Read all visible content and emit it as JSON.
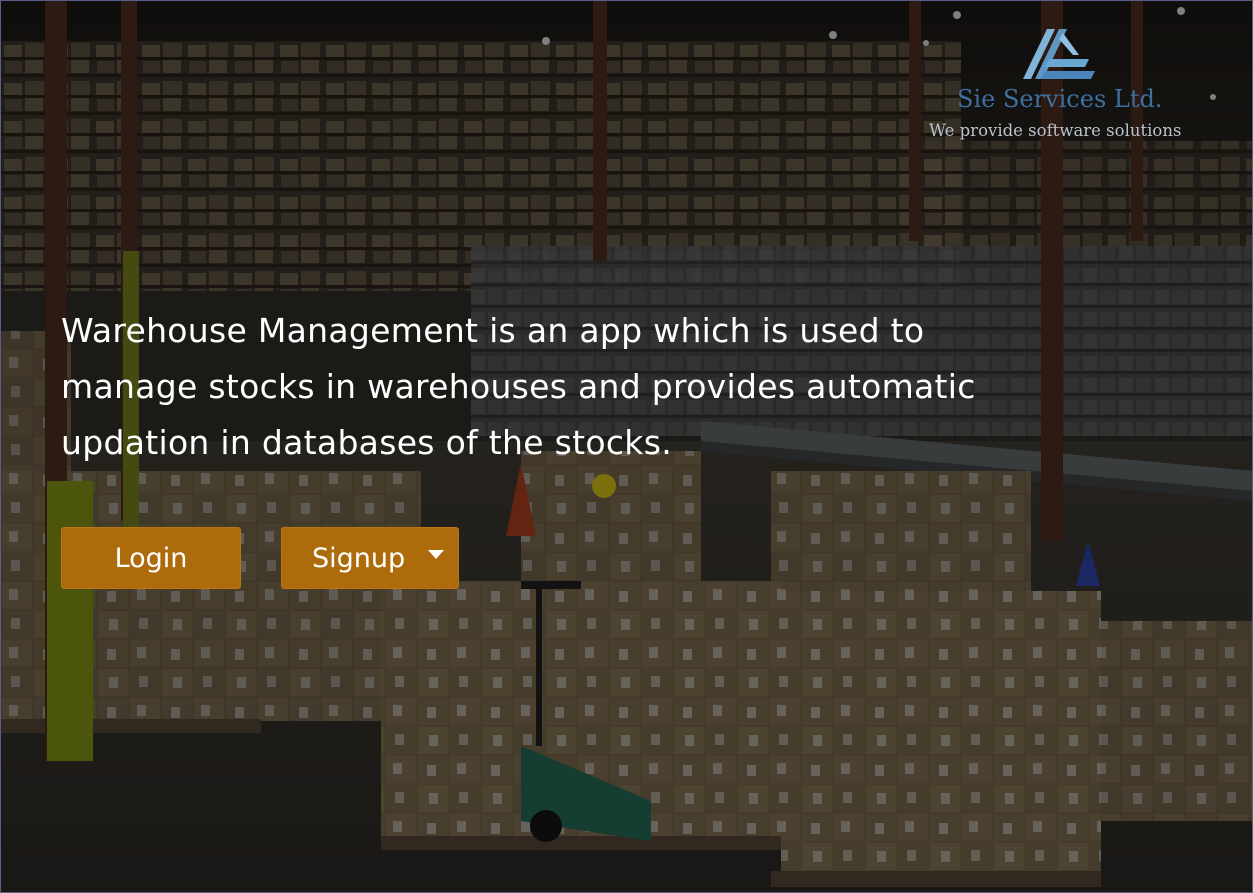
{
  "brand": {
    "name": "Sie Services Ltd.",
    "tagline": "We provide software solutions",
    "logo_icon": "stacked-parallelogram-logo-icon",
    "name_color": "#3f6f9e",
    "tagline_color": "#b9c2cc"
  },
  "hero": {
    "description": "Warehouse Management is an app which is used to manage stocks in warehouses and provides automatic updation in databases of the stocks.",
    "background": "warehouse-shelves-and-boxes-photo"
  },
  "actions": {
    "login_label": "Login",
    "signup_label": "Signup",
    "signup_dropdown_icon": "caret-down-icon",
    "button_color": "#ad6b0b"
  }
}
